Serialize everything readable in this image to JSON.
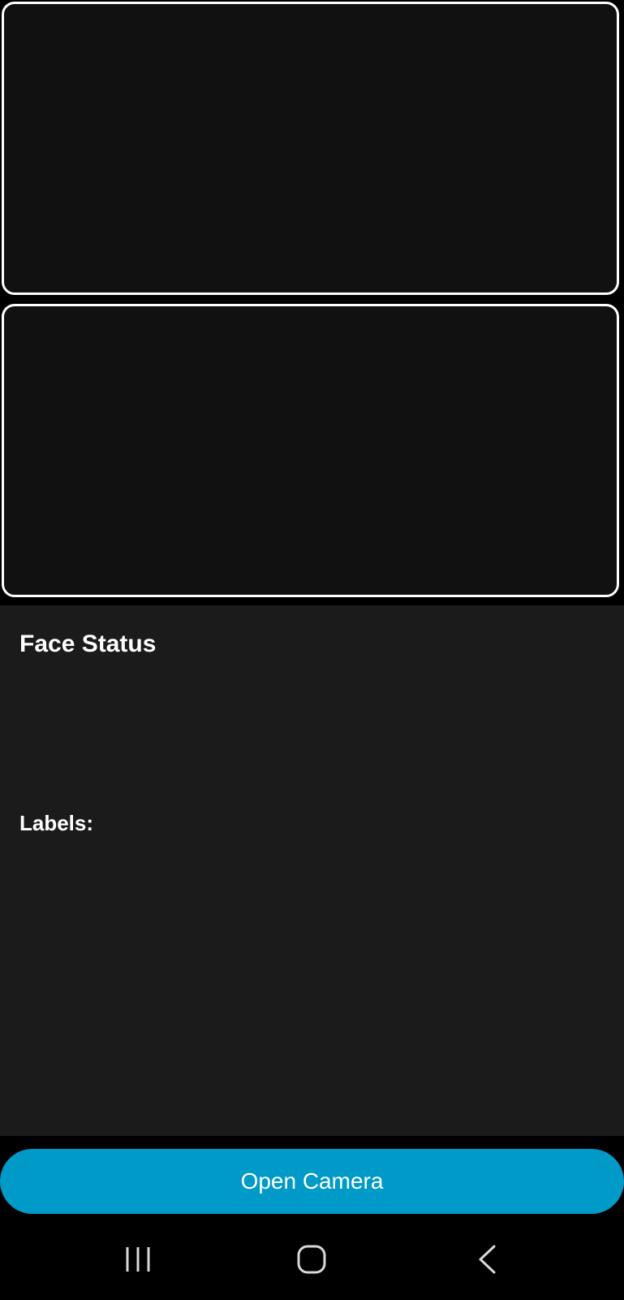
{
  "status_panel": {
    "title": "Face Status",
    "labels_heading": "Labels:"
  },
  "actions": {
    "open_camera_label": "Open Camera"
  },
  "colors": {
    "background": "#000000",
    "panel": "#1b1b1b",
    "preview": "#111111",
    "accent": "#009ac9",
    "text": "#ffffff",
    "nav_icon": "#d9d9d9"
  },
  "nav_bar": {
    "icons": [
      "recents-icon",
      "home-icon",
      "back-icon"
    ]
  }
}
